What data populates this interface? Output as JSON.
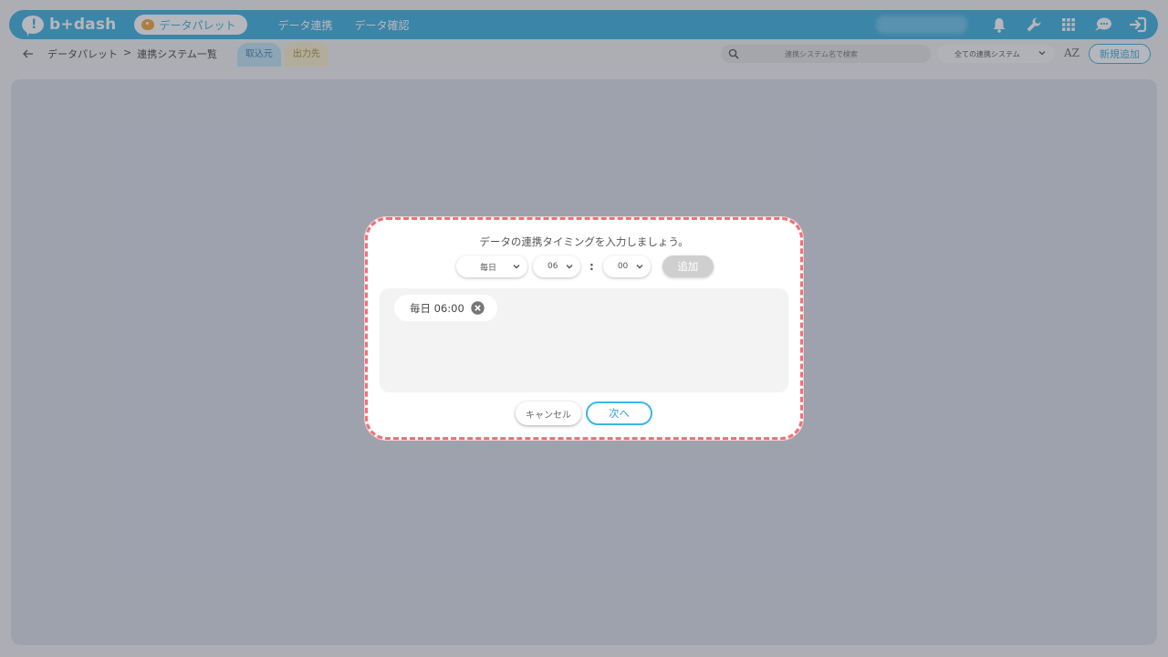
{
  "header": {
    "logo_text": "b+dash",
    "palette_label": "データパレット",
    "nav": [
      "データ連携",
      "データ確認"
    ],
    "icons": [
      "bell-icon",
      "wrench-icon",
      "grid-icon",
      "chat-icon",
      "logout-icon"
    ]
  },
  "subbar": {
    "breadcrumb_root": "データパレット",
    "breadcrumb_sep": ">",
    "breadcrumb_current": "連携システム一覧",
    "tabs": [
      "取込元",
      "出力先"
    ],
    "search_placeholder": "連携システム名で検索",
    "system_filter": "全ての連携システム",
    "sort_label": "AZ",
    "new_button": "新規追加"
  },
  "modal": {
    "title": "データの連携タイミングを入力しましょう。",
    "frequency": "毎日",
    "hour": "06",
    "colon": ":",
    "minute": "00",
    "add_label": "追加",
    "schedules": [
      "毎日 06:00"
    ],
    "cancel_label": "キャンセル",
    "next_label": "次へ"
  },
  "colors": {
    "accent": "#3aaee0",
    "highlight_border": "#ef7178"
  }
}
